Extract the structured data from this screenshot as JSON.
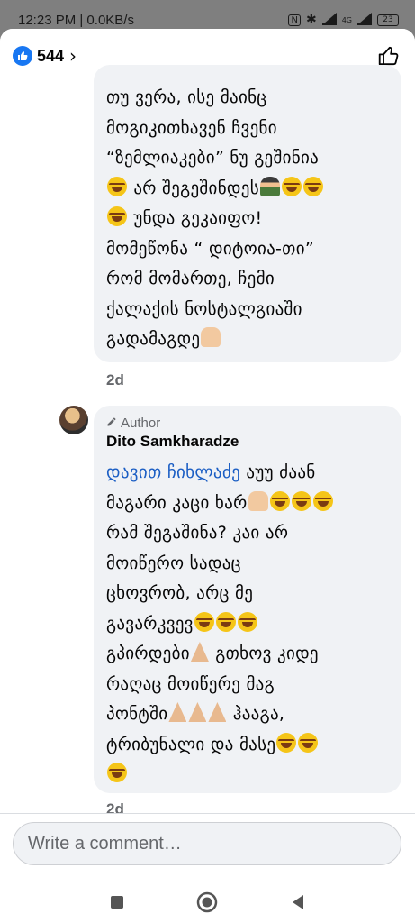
{
  "status_bar": {
    "time_speed": "12:23 PM | 0.0KB/s",
    "nfc": "N",
    "network": "4G",
    "battery": "23"
  },
  "header": {
    "reaction_count": "544",
    "chevron": "›",
    "like_icon": "thumbs-up-outline-icon"
  },
  "comments": [
    {
      "lines": [
        "თუ ვერა, ისე მაინც",
        "მოგიკითხავენ ჩვენი",
        "“ზემლიაკები”  ნუ გეშინია",
        "{laugh} არ შეგეშინდეს{person}{laugh}{laugh}",
        "{laugh} უნდა გეკაიფო!",
        "მომეწონა “ დიტოია-თი”",
        "რომ მომართე, ჩემი",
        "ქალაქის ნოსტალგიაში",
        "გადამაგდე{hands}"
      ],
      "time": "2d"
    },
    {
      "author_badge": "Author",
      "author_name": "Dito Samkharadze",
      "mention": "დავით ჩიხლაძე",
      "lines": [
        " აუუ ძაან",
        "მაგარი კაცი ხარ{clap}{laugh}{laugh}{laugh}",
        "რამ შეგაშინა? კაი არ",
        "მოიწერო სადაც",
        "ცხოვრობ, არც მე",
        "გავარკვევ{laugh}{laugh}{laugh}",
        "გპირდები{pray} გთხოვ კიდე",
        "რაღაც მოიწერე მაგ",
        "პონტში{pray}{pray}{pray} ჰააგა,",
        "ტრიბუნალი და მასე{laugh}{laugh}",
        "{laugh}"
      ],
      "time": "2d"
    }
  ],
  "composer": {
    "placeholder": "Write a comment…"
  },
  "navbar": {
    "recents_icon": "square-icon",
    "home_icon": "circle-icon",
    "back_icon": "triangle-back-icon"
  },
  "colors": {
    "like_blue": "#1877f2",
    "bubble_bg": "#f0f2f5",
    "mention_blue": "#1b5ec4",
    "meta_grey": "#65676b"
  }
}
